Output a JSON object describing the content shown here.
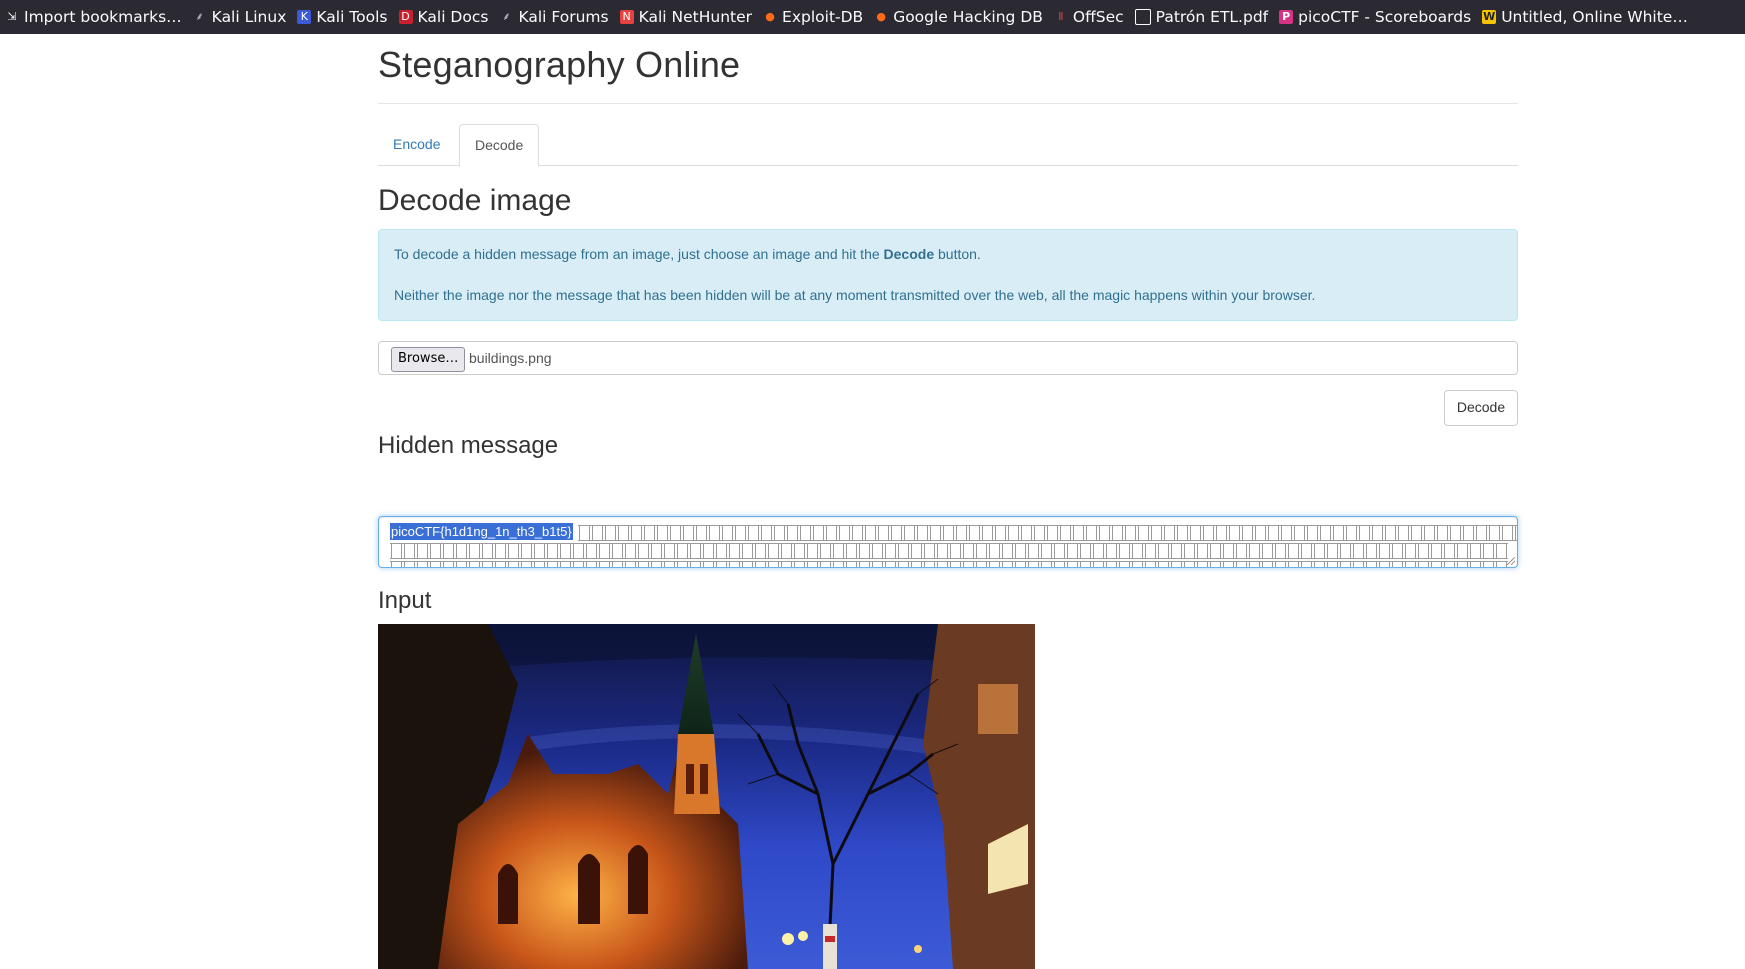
{
  "bookmarks": [
    {
      "label": "Import bookmarks…",
      "icon": "import-icon"
    },
    {
      "label": "Kali Linux",
      "icon": "kali-dragon-icon"
    },
    {
      "label": "Kali Tools",
      "icon": "kali-tools-icon"
    },
    {
      "label": "Kali Docs",
      "icon": "kali-docs-icon"
    },
    {
      "label": "Kali Forums",
      "icon": "kali-dragon-icon"
    },
    {
      "label": "Kali NetHunter",
      "icon": "nethunter-icon"
    },
    {
      "label": "Exploit-DB",
      "icon": "exploit-db-icon"
    },
    {
      "label": "Google Hacking DB",
      "icon": "ghdb-icon"
    },
    {
      "label": "OffSec",
      "icon": "offsec-icon"
    },
    {
      "label": "Patrón ETL.pdf",
      "icon": "globe-icon"
    },
    {
      "label": "picoCTF - Scoreboards",
      "icon": "picoctf-icon"
    },
    {
      "label": "Untitled, Online White…",
      "icon": "whiteboard-icon"
    }
  ],
  "page": {
    "title": "Steganography Online",
    "tabs": {
      "encode": "Encode",
      "decode": "Decode"
    },
    "active_tab": "Decode"
  },
  "decode": {
    "heading": "Decode image",
    "info_line1_before": "To decode a hidden message from an image, just choose an image and hit the ",
    "info_line1_bold": "Decode",
    "info_line1_after": " button.",
    "info_line2": "Neither the image nor the message that has been hidden will be at any moment transmitted over the web, all the magic happens within your browser.",
    "browse_label": "Browse…",
    "file_name": "buildings.png",
    "decode_button": "Decode"
  },
  "hidden_message": {
    "heading": "Hidden message",
    "value": "picoCTF{h1d1ng_1n_th3_b1t5}"
  },
  "input": {
    "heading": "Input"
  },
  "colors": {
    "bookmark_bar_bg": "#2b2a33",
    "link": "#337ab7",
    "alert_bg": "#d9edf7",
    "alert_text": "#31708f",
    "selection": "#3b6fd8"
  }
}
